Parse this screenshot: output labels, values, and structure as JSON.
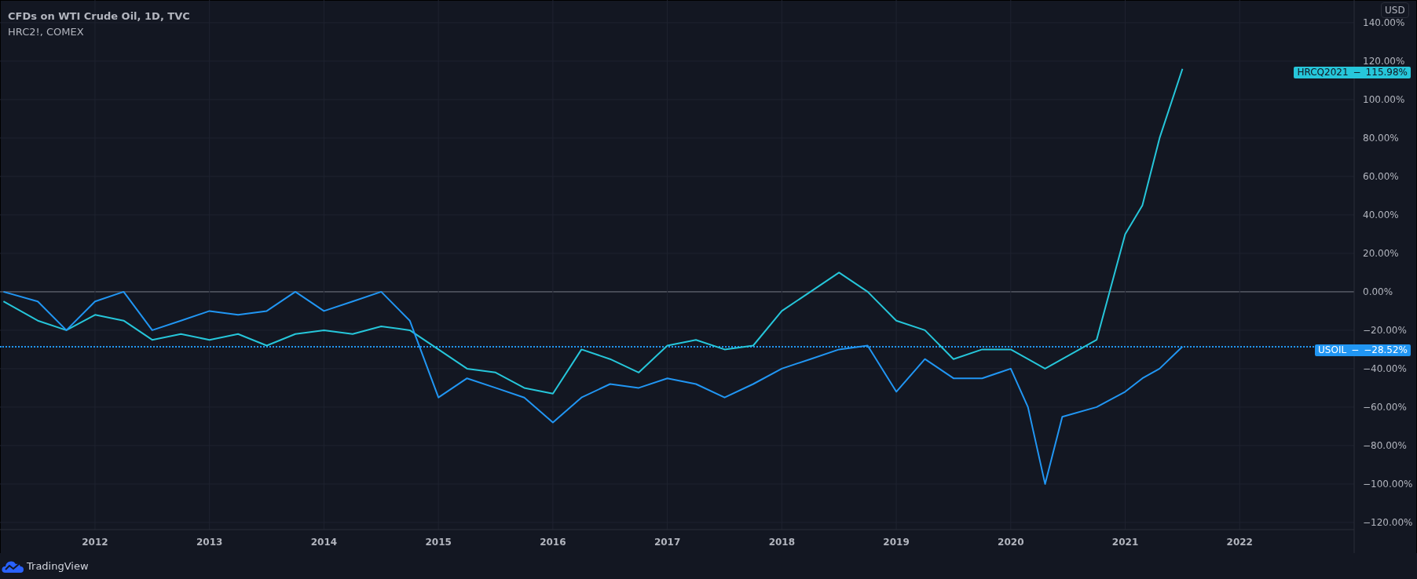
{
  "legend": [
    {
      "text": "CFDs on WTI Crude Oil, 1D, TVC",
      "kind": "main"
    },
    {
      "text": "HRC2!, COMEX",
      "kind": "compare"
    }
  ],
  "currency": "USD",
  "chart_data": {
    "type": "line",
    "grid": true,
    "xlim": [
      2011.17,
      2023.0
    ],
    "ylim": [
      -123.7,
      151.8
    ],
    "yticks": [
      {
        "value": 140,
        "label": "140.00%"
      },
      {
        "value": 120,
        "label": "120.00%"
      },
      {
        "value": 100,
        "label": "100.00%"
      },
      {
        "value": 80,
        "label": "80.00%"
      },
      {
        "value": 60,
        "label": "60.00%"
      },
      {
        "value": 40,
        "label": "40.00%"
      },
      {
        "value": 20,
        "label": "20.00%"
      },
      {
        "value": 0,
        "label": "0.00%"
      },
      {
        "value": -20,
        "label": "−20.00%"
      },
      {
        "value": -40,
        "label": "−40.00%"
      },
      {
        "value": -60,
        "label": "−60.00%"
      },
      {
        "value": -80,
        "label": "−80.00%"
      },
      {
        "value": -100,
        "label": "−100.00%"
      },
      {
        "value": -120,
        "label": "−120.00%"
      }
    ],
    "xticks": [
      {
        "value": 2012,
        "label": "2012"
      },
      {
        "value": 2013,
        "label": "2013"
      },
      {
        "value": 2014,
        "label": "2014"
      },
      {
        "value": 2015,
        "label": "2015"
      },
      {
        "value": 2016,
        "label": "2016"
      },
      {
        "value": 2017,
        "label": "2017"
      },
      {
        "value": 2018,
        "label": "2018"
      },
      {
        "value": 2019,
        "label": "2019"
      },
      {
        "value": 2020,
        "label": "2020"
      },
      {
        "value": 2021,
        "label": "2021"
      },
      {
        "value": 2022,
        "label": "2022"
      }
    ],
    "x": [
      2011.2,
      2011.5,
      2011.75,
      2012.0,
      2012.25,
      2012.5,
      2012.75,
      2013.0,
      2013.25,
      2013.5,
      2013.75,
      2014.0,
      2014.25,
      2014.5,
      2014.75,
      2015.0,
      2015.25,
      2015.5,
      2015.75,
      2016.0,
      2016.25,
      2016.5,
      2016.75,
      2017.0,
      2017.25,
      2017.5,
      2017.75,
      2018.0,
      2018.25,
      2018.5,
      2018.75,
      2019.0,
      2019.25,
      2019.5,
      2019.75,
      2020.0,
      2020.15,
      2020.3,
      2020.45,
      2020.75,
      2021.0,
      2021.15,
      2021.3,
      2021.5
    ],
    "series": [
      {
        "name": "HRCQ2021",
        "color": "#26c6da",
        "values": [
          -5,
          -15,
          -20,
          -12,
          -15,
          -25,
          -22,
          -25,
          -22,
          -28,
          -22,
          -20,
          -22,
          -18,
          -20,
          -30,
          -40,
          -42,
          -50,
          -53,
          -30,
          -35,
          -42,
          -28,
          -25,
          -30,
          -28,
          -10,
          0,
          10,
          0,
          -15,
          -20,
          -35,
          -30,
          -30,
          -35,
          -40,
          -35,
          -25,
          30,
          45,
          80,
          116
        ]
      },
      {
        "name": "USOIL",
        "color": "#2196f3",
        "values": [
          0,
          -5,
          -20,
          -5,
          0,
          -20,
          -15,
          -10,
          -12,
          -10,
          0,
          -10,
          -5,
          0,
          -15,
          -55,
          -45,
          -50,
          -55,
          -68,
          -55,
          -48,
          -50,
          -45,
          -48,
          -55,
          -48,
          -40,
          -35,
          -30,
          -28,
          -52,
          -35,
          -45,
          -45,
          -40,
          -60,
          -100,
          -65,
          -60,
          -52,
          -45,
          -40,
          -28.5
        ]
      }
    ]
  },
  "price_labels": [
    {
      "separator": "−",
      "value": "115.98%",
      "dotted": false
    },
    {
      "separator": "−",
      "value": "−28.52%",
      "dotted": true
    }
  ],
  "footer": {
    "brand": "TradingView"
  }
}
